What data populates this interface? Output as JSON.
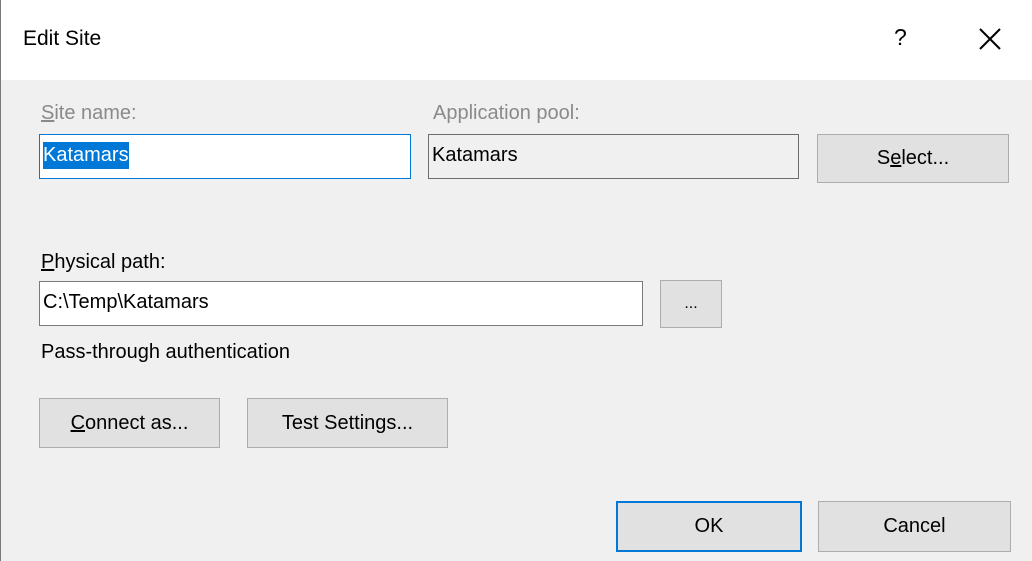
{
  "dialog": {
    "title": "Edit Site",
    "help_label": "?",
    "close_label": "close"
  },
  "site_name": {
    "label_first": "S",
    "label_rest": "ite name:",
    "value": "Katamars"
  },
  "app_pool": {
    "label": "Application pool:",
    "value": "Katamars"
  },
  "select_button": {
    "pre": "S",
    "underlined": "e",
    "post": "lect..."
  },
  "physical_path": {
    "label_first": "P",
    "label_rest": "hysical path:",
    "value": "C:\\Temp\\Katamars",
    "browse_label": "..."
  },
  "auth_text": "Pass-through authentication",
  "connect_button": {
    "underlined": "C",
    "rest": "onnect as..."
  },
  "test_button": {
    "pre": "Test Settin",
    "underlined": "g",
    "post": "s..."
  },
  "ok_label": "OK",
  "cancel_label": "Cancel",
  "colors": {
    "accent": "#0078d7",
    "button_face": "#e1e1e1",
    "dialog_bg": "#f0f0f0"
  },
  "icons": {
    "close": "close-icon"
  }
}
